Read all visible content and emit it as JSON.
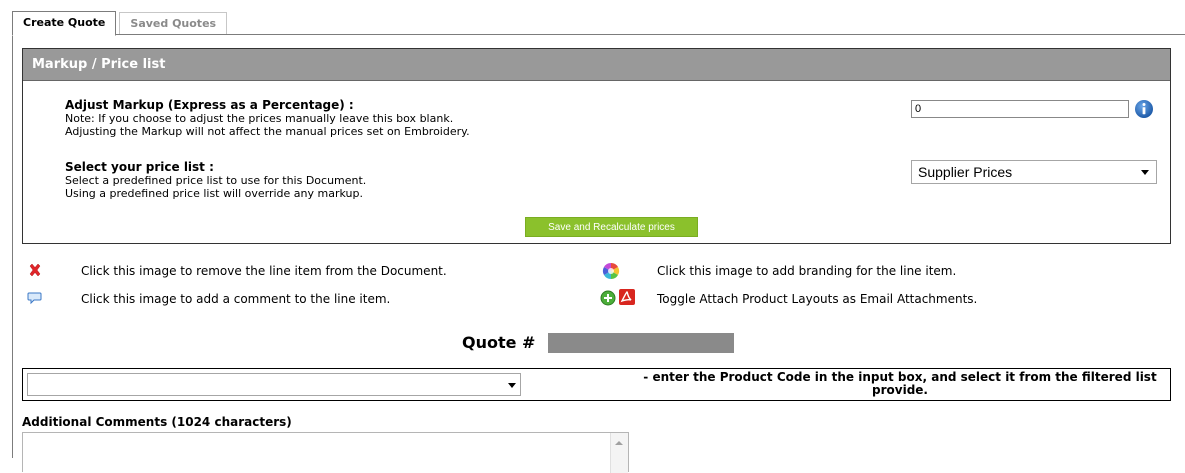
{
  "tabs": [
    {
      "label": "Create Quote",
      "active": true
    },
    {
      "label": "Saved Quotes",
      "active": false
    }
  ],
  "markup_panel": {
    "title": "Markup / Price list",
    "adjust_markup": {
      "title": "Adjust Markup (Express as a Percentage) :",
      "note1": "Note: If you choose to adjust the prices manually leave this box blank.",
      "note2": "Adjusting the Markup will not affect the manual prices set on Embroidery.",
      "value": "0",
      "info_icon": "info-icon"
    },
    "price_list": {
      "title": "Select your price list :",
      "desc1": "Select a predefined price list to use for this Document.",
      "desc2": "Using a predefined price list will override any markup.",
      "selected": "Supplier Prices"
    },
    "save_button": "Save and Recalculate prices"
  },
  "legend": [
    {
      "icon": "red-x-icon",
      "text": "Click this image to remove the line item from the Document."
    },
    {
      "icon": "comment-bubble-icon",
      "text": "Click this image to add a comment to the line item."
    },
    {
      "icon": "color-wheel-icon",
      "text": "Click this image to add branding for the line item."
    },
    {
      "icon": "add-pdf-icon",
      "text": "Toggle Attach Product Layouts as Email Attachments."
    }
  ],
  "quote": {
    "label": "Quote #",
    "number": ""
  },
  "product": {
    "selected": "",
    "hint": "- enter the Product Code in the input box, and select it from the filtered list provide."
  },
  "comments": {
    "label": "Additional Comments (1024 characters)",
    "value": ""
  },
  "colors": {
    "panel_header": "#999999",
    "save_button": "#8bc12c",
    "quote_bar": "#8a8a8a",
    "info_icon": "#2a6ab5"
  }
}
